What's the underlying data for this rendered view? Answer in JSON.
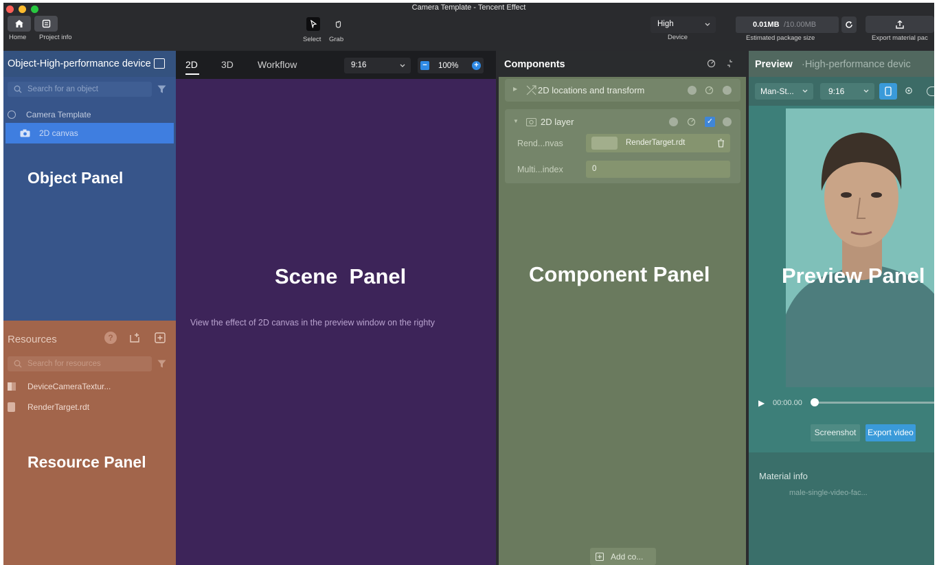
{
  "window": {
    "title": "Camera Template - Tencent Effect"
  },
  "toolbar": {
    "home_label": "Home",
    "project_info_label": "Project info",
    "select_label": "Select",
    "grab_label": "Grab",
    "quality_value": "High",
    "device_label": "Device",
    "package_size": "0.01MB",
    "package_limit": "/10.00MB",
    "package_caption": "Estimated package size",
    "export_label": "Export material pac"
  },
  "object_panel": {
    "header": "Object-High-performance device",
    "search_placeholder": "Search for an object",
    "tree": [
      {
        "label": "Camera Template"
      },
      {
        "label": "2D canvas",
        "selected": true
      }
    ],
    "overlay_label": "Object Panel"
  },
  "resources_panel": {
    "header": "Resources",
    "search_placeholder": "Search for resources",
    "items": [
      {
        "label": "DeviceCameraTextur..."
      },
      {
        "label": "RenderTarget.rdt"
      }
    ],
    "overlay_label": "Resource Panel"
  },
  "scene_panel": {
    "tabs": [
      {
        "label": "2D",
        "active": true
      },
      {
        "label": "3D"
      },
      {
        "label": "Workflow"
      }
    ],
    "ratio": "9:16",
    "zoom": "100%",
    "hint": "View the effect of 2D canvas in the preview window on the righty",
    "overlay_label": "Scene  Panel"
  },
  "components_panel": {
    "header": "Components",
    "sections": [
      {
        "title": "2D locations and transform",
        "expanded": false
      },
      {
        "title": "2D layer",
        "expanded": true
      }
    ],
    "fields": [
      {
        "label": "Rend...nvas",
        "value": "RenderTarget.rdt"
      },
      {
        "label": "Multi...index",
        "value": "0"
      }
    ],
    "add_button": "Add co...",
    "overlay_label": "Component Panel"
  },
  "preview_panel": {
    "header": "Preview",
    "subheader": "·High-performance devic",
    "model": "Man-St...",
    "ratio": "9:16",
    "time": "00:00.00",
    "screenshot_label": "Screenshot",
    "export_video_label": "Export video",
    "material_info_label": "Material info",
    "material_name": "male-single-video-fac...",
    "overlay_label": "Preview Panel"
  },
  "colors": {
    "object_tint": "#3b5a93",
    "resource_tint": "#a2654b",
    "scene_tint": "#3d2459",
    "component_tint": "#6a7a5e",
    "preview_tint": "#3f7a74",
    "accent": "#2f8ae5"
  }
}
